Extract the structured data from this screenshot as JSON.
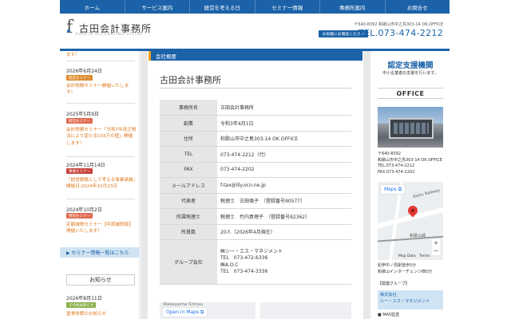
{
  "nav": [
    "ホーム",
    "サービス案内",
    "経営を考える日",
    "セミナー情報",
    "事務所案内",
    "お問合せ"
  ],
  "header": {
    "logo_mark": "f",
    "logo_name": "古田会計事務所",
    "logo_sub": "FURUTA ACCOUNTING OFFICE",
    "address": "〒640-8392 和歌山市中之島303-14 OK.OFFICE",
    "contact_button": "お気軽にお電話ください",
    "tel": "TEL.073-474-2212"
  },
  "left": {
    "note": "ます！",
    "news": [
      {
        "date": "2026年6月24日",
        "badge": "経営セミナー",
        "text": "会計税務セミナー開催いたします！"
      },
      {
        "date": "2025年5月9日",
        "badge": "経営セミナー",
        "text": "会計税務セミナー「令和7年改正税法により変わる103万の壁」開催します！"
      },
      {
        "date": "2024年11月14日",
        "badge": "事業セミナー",
        "text": "「経営戦略として考える事業承継」開催日:2024年10月23日"
      },
      {
        "date": "2024年10月2日",
        "badge": "特別セミナー",
        "text": "定額減税セミナー【年調減税版】開催いたします！"
      }
    ],
    "list_button": "▶ セミナー情報一覧はこちら",
    "oshirase_title": "お知らせ",
    "oshirase_date": "2026年8月11日",
    "oshirase_badge": "その他お知らせ",
    "oshirase_text": "夏季休暇のお知らせ"
  },
  "main": {
    "section_header": "会社概要",
    "title": "古田会計事務所",
    "table": [
      {
        "label": "事務所名",
        "value": "古田会計事務所"
      },
      {
        "label": "創業",
        "value": "令和3年4月1日"
      },
      {
        "label": "住所",
        "value": "和歌山市中之島303-14 OK.OFFICE"
      },
      {
        "label": "TEL",
        "value": "073-474-2212（代）"
      },
      {
        "label": "FAX",
        "value": "073-474-2202"
      },
      {
        "label": "メールアドレス",
        "value": "f-tax@lily.ocn.ne.jp"
      },
      {
        "label": "代表者",
        "value": "税理士　古田倫子　（登録番号90577）"
      },
      {
        "label": "所属税理士",
        "value": "税理士　竹内貢理子　（登録番号92362）"
      },
      {
        "label": "所員数",
        "value": "20人（2026年4月現在）"
      }
    ],
    "group": {
      "label": "グループ会社",
      "lines": [
        "㈱シー・エス・マネジメント",
        "TEL　073-472-6336",
        "㈱A.O.C",
        "TEL　073-474-3336"
      ]
    },
    "map_top": "Wakayama Shinsu",
    "map_button": "Open in Maps ⧉"
  },
  "right": {
    "heading": "認定支援機関",
    "heading_sub": "中小企業者の支援を行います。",
    "office_title": "OFFICE",
    "info": [
      "〒640-8392",
      "和歌山市中之島303-14 OK.OFFICE",
      "TEL.073-474-2212",
      "FAX.073-474-2202"
    ],
    "map_button": "Maps ⧉",
    "map_label_road": "Kishu Railway",
    "map_label_station": "和歌山城",
    "map_credit": "Map Data　Terms",
    "access": [
      "紀伊中ノ島駅徒歩5分",
      "和歌山インターチェンジ西5分"
    ],
    "group_title": "【関連グループ】",
    "group_box": [
      "株式会社",
      "シー・エス・マネジメント"
    ],
    "mas": "■ MAS監査"
  }
}
